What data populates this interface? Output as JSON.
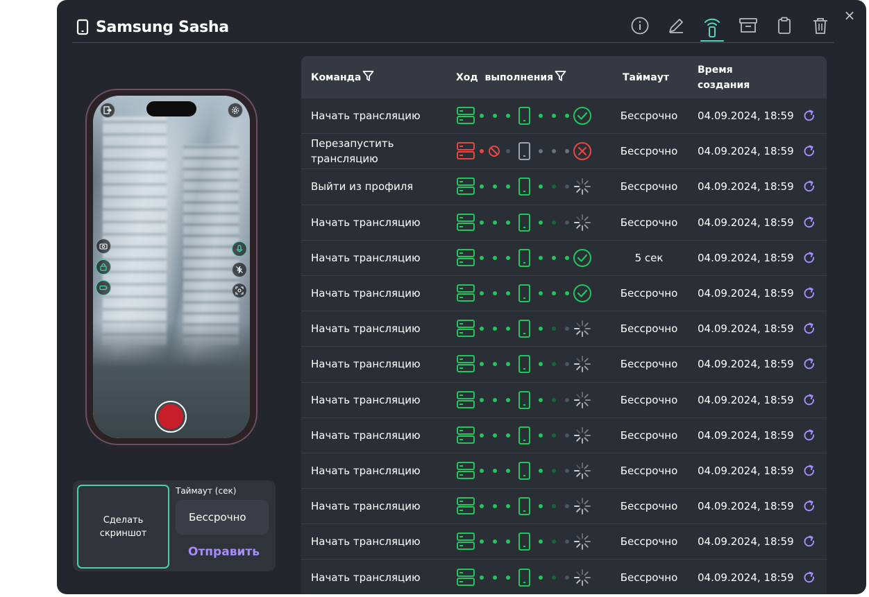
{
  "window": {
    "title": "Samsung Sasha",
    "close_label": "×",
    "toolbar": [
      {
        "name": "info-button",
        "icon": "info-icon",
        "active": false
      },
      {
        "name": "edit-button",
        "icon": "pencil-icon",
        "active": false
      },
      {
        "name": "broadcast-button",
        "icon": "broadcast-icon",
        "active": true
      },
      {
        "name": "archive-button",
        "icon": "archive-icon",
        "active": false
      },
      {
        "name": "clipboard-button",
        "icon": "clipboard-icon",
        "active": false
      },
      {
        "name": "delete-button",
        "icon": "trash-icon",
        "active": false
      }
    ]
  },
  "colors": {
    "accent": "#54d6ba",
    "success": "#22c55e",
    "error": "#ef4444",
    "pending": "#4b5563",
    "link": "#a78bfa"
  },
  "controls": {
    "screenshot_label": "Сделать скриншот",
    "timeout_label": "Таймаут (сек)",
    "timeout_value": "Бессрочно",
    "send_label": "Отправить"
  },
  "table": {
    "columns": {
      "command": "Команда",
      "progress": "Ход  выполнения",
      "timeout": "Таймаут",
      "created": "Время создания"
    },
    "rows": [
      {
        "command": "Начать трансляцию",
        "status": "done",
        "timeout": "Бессрочно",
        "created": "04.09.2024, 18:59"
      },
      {
        "command": "Перезапустить трансляцию",
        "status": "error",
        "timeout": "Бессрочно",
        "created": "04.09.2024, 18:59"
      },
      {
        "command": "Выйти из профиля",
        "status": "pending",
        "timeout": "Бессрочно",
        "created": "04.09.2024, 18:59"
      },
      {
        "command": "Начать трансляцию",
        "status": "pending",
        "timeout": "Бессрочно",
        "created": "04.09.2024, 18:59"
      },
      {
        "command": "Начать трансляцию",
        "status": "done",
        "timeout": "5 сек",
        "created": "04.09.2024, 18:59"
      },
      {
        "command": "Начать трансляцию",
        "status": "done",
        "timeout": "Бессрочно",
        "created": "04.09.2024, 18:59"
      },
      {
        "command": "Начать трансляцию",
        "status": "pending",
        "timeout": "Бессрочно",
        "created": "04.09.2024, 18:59"
      },
      {
        "command": "Начать трансляцию",
        "status": "pending",
        "timeout": "Бессрочно",
        "created": "04.09.2024, 18:59"
      },
      {
        "command": "Начать трансляцию",
        "status": "pending",
        "timeout": "Бессрочно",
        "created": "04.09.2024, 18:59"
      },
      {
        "command": "Начать трансляцию",
        "status": "pending",
        "timeout": "Бессрочно",
        "created": "04.09.2024, 18:59"
      },
      {
        "command": "Начать трансляцию",
        "status": "pending",
        "timeout": "Бессрочно",
        "created": "04.09.2024, 18:59"
      },
      {
        "command": "Начать трансляцию",
        "status": "pending",
        "timeout": "Бессрочно",
        "created": "04.09.2024, 18:59"
      },
      {
        "command": "Начать трансляцию",
        "status": "pending",
        "timeout": "Бессрочно",
        "created": "04.09.2024, 18:59"
      },
      {
        "command": "Начать трансляцию",
        "status": "pending",
        "timeout": "Бессрочно",
        "created": "04.09.2024, 18:59"
      }
    ]
  }
}
